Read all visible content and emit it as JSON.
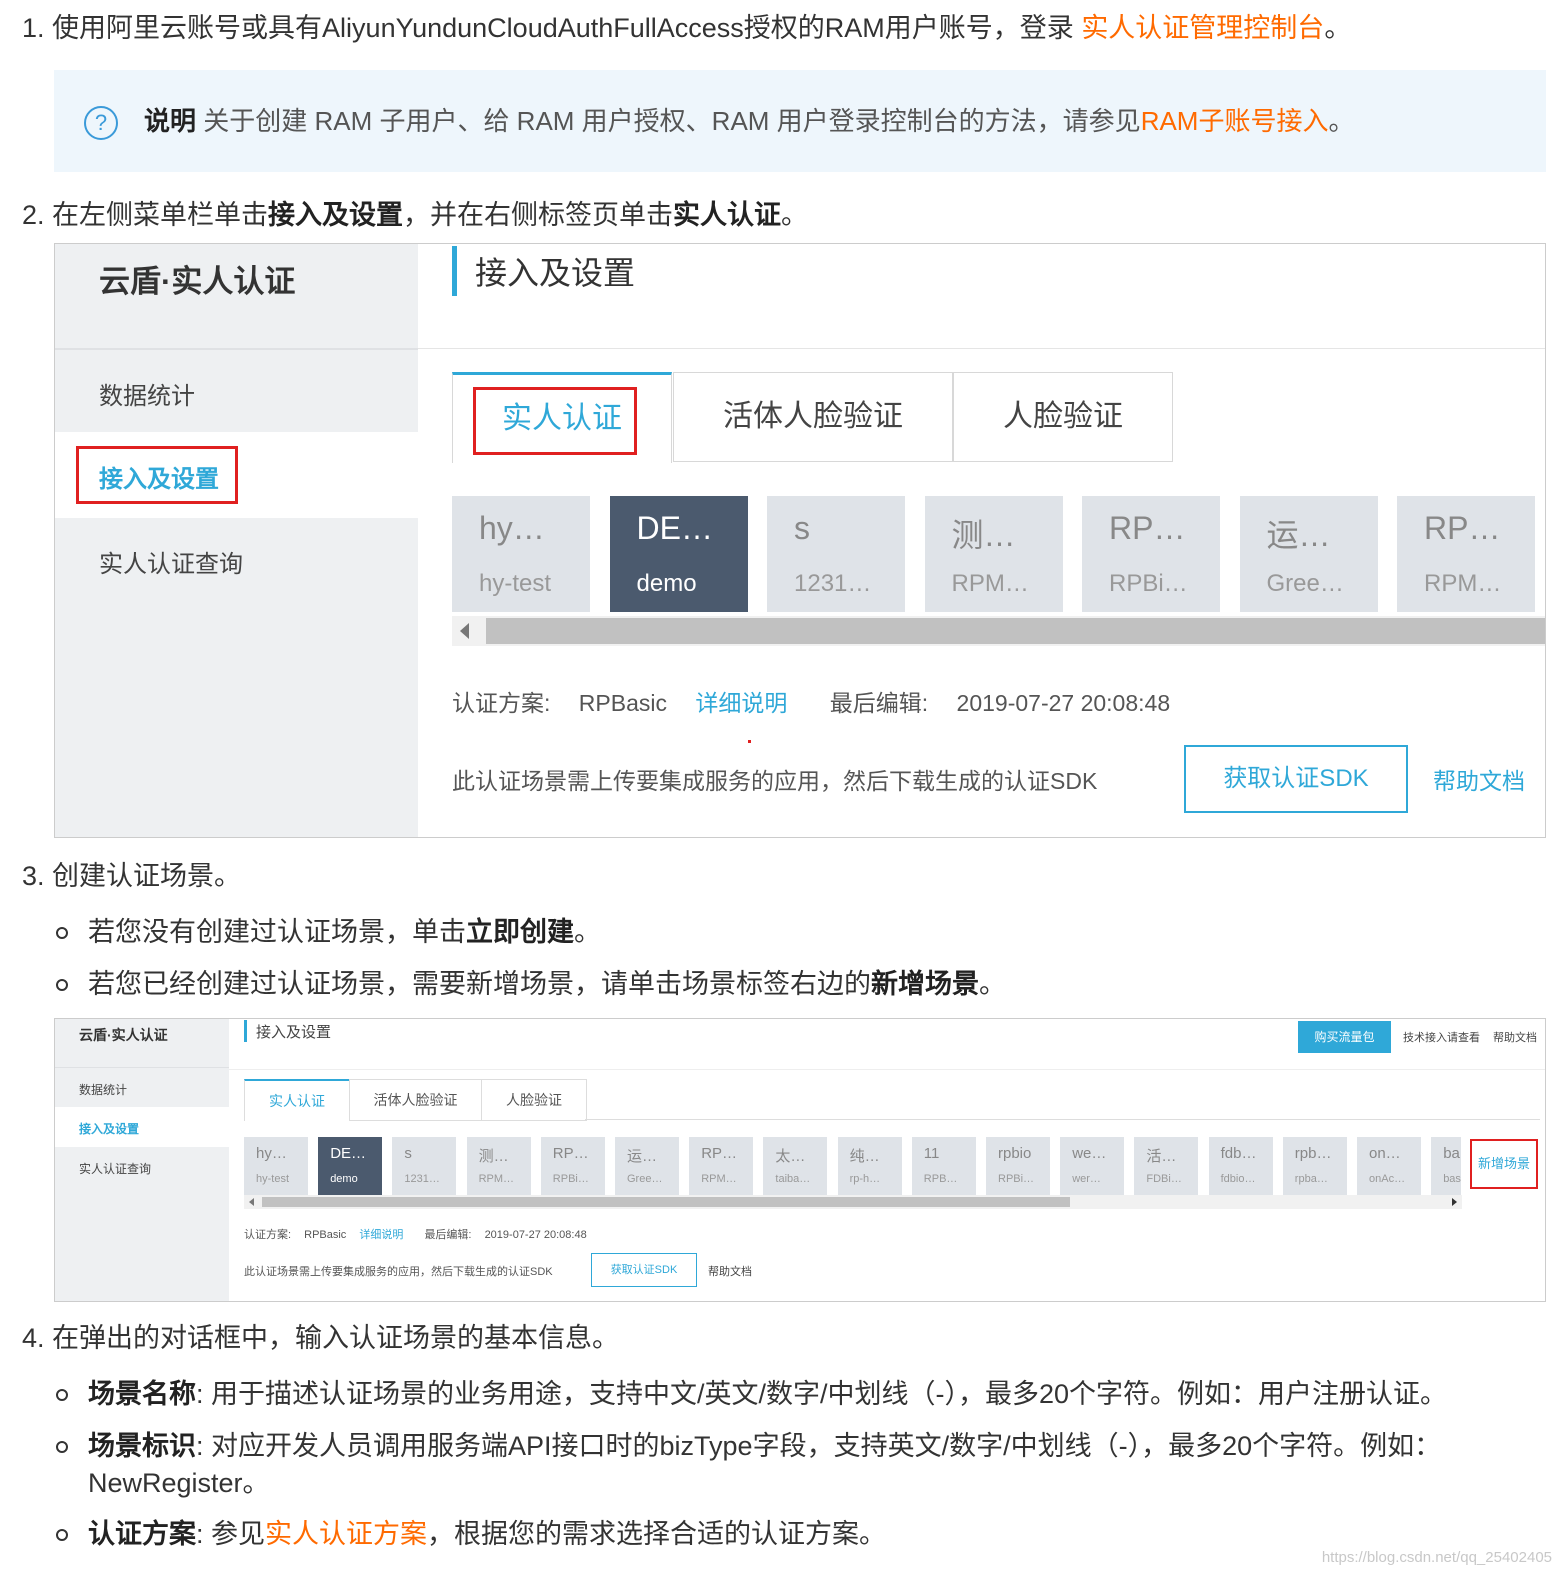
{
  "step1": {
    "num": "1.",
    "text": "使用阿里云账号或具有AliyunYundunCloudAuthFullAccess授权的RAM用户账号，登录 ",
    "link": "实人认证管理控制台",
    "end": "。"
  },
  "note": {
    "label": "说明",
    "text": " 关于创建 RAM 子用户、给 RAM 用户授权、RAM 用户登录控制台的方法，请参见",
    "link": "RAM子账号接入",
    "end": "。"
  },
  "step2": {
    "num": "2.",
    "t1": "在左侧菜单栏单击",
    "b1": "接入及设置",
    "t2": "，并在右侧标签页单击",
    "b2": "实人认证",
    "t3": "。"
  },
  "shot1": {
    "brand": "云盾·实人认证",
    "menu": [
      "数据统计",
      "接入及设置",
      "实人认证查询"
    ],
    "title": "接入及设置",
    "tabs": [
      "实人认证",
      "活体人脸验证",
      "人脸验证"
    ],
    "cards": [
      {
        "t1": "hy…",
        "t2": "hy-test"
      },
      {
        "t1": "DE…",
        "t2": "demo"
      },
      {
        "t1": "s",
        "t2": "1231…"
      },
      {
        "t1": "测…",
        "t2": "RPM…"
      },
      {
        "t1": "RP…",
        "t2": "RPBi…"
      },
      {
        "t1": "运…",
        "t2": "Gree…"
      },
      {
        "t1": "RP…",
        "t2": "RPM…"
      }
    ],
    "scheme_label": "认证方案:",
    "scheme_value": "RPBasic",
    "detail_link": "详细说明",
    "edit_label": "最后编辑:",
    "edit_value": "2019-07-27 20:08:48",
    "sdk_text": "此认证场景需上传要集成服务的应用，然后下载生成的认证SDK",
    "sdk_button": "获取认证SDK",
    "help_link": "帮助文档"
  },
  "step3": {
    "num": "3.",
    "text": "创建认证场景。",
    "b1_t": "若您没有创建过认证场景，单击",
    "b1_b": "立即创建",
    "b1_e": "。",
    "b2_t": "若您已经创建过认证场景，需要新增场景，请单击场景标签右边的",
    "b2_b": "新增场景",
    "b2_e": "。"
  },
  "shot2": {
    "brand": "云盾·实人认证",
    "menu": [
      "数据统计",
      "接入及设置",
      "实人认证查询"
    ],
    "title": "接入及设置",
    "buy_button": "购买流量包",
    "tech_text": "技术接入请查看",
    "help_top": "帮助文档",
    "tabs": [
      "实人认证",
      "活体人脸验证",
      "人脸验证"
    ],
    "cards": [
      {
        "t1": "hy…",
        "t2": "hy-test"
      },
      {
        "t1": "DE…",
        "t2": "demo"
      },
      {
        "t1": "s",
        "t2": "1231…"
      },
      {
        "t1": "测…",
        "t2": "RPM…"
      },
      {
        "t1": "RP…",
        "t2": "RPBi…"
      },
      {
        "t1": "运…",
        "t2": "Gree…"
      },
      {
        "t1": "RP…",
        "t2": "RPM…"
      },
      {
        "t1": "太…",
        "t2": "taiba…"
      },
      {
        "t1": "纯…",
        "t2": "rp-h…"
      },
      {
        "t1": "11",
        "t2": "RPB…"
      },
      {
        "t1": "rpbio",
        "t2": "RPBi…"
      },
      {
        "t1": "we…",
        "t2": "wer…"
      },
      {
        "t1": "活…",
        "t2": "FDBi…"
      },
      {
        "t1": "fdb…",
        "t2": "fdbio…"
      },
      {
        "t1": "rpb…",
        "t2": "rpba…"
      },
      {
        "t1": "on…",
        "t2": "onAc…"
      },
      {
        "t1": "ba",
        "t2": "bas"
      }
    ],
    "add_scene": "新增场景",
    "scheme_label": "认证方案:",
    "scheme_value": "RPBasic",
    "detail_link": "详细说明",
    "edit_label": "最后编辑:",
    "edit_value": "2019-07-27 20:08:48",
    "sdk_text": "此认证场景需上传要集成服务的应用，然后下载生成的认证SDK",
    "sdk_button": "获取认证SDK",
    "help_link": "帮助文档"
  },
  "step4": {
    "num": "4.",
    "text": "在弹出的对话框中，输入认证场景的基本信息。",
    "i1_b": "场景名称",
    "i1_t": ": 用于描述认证场景的业务用途，支持中文/英文/数字/中划线（-），最多20个字符。例如：用户注册认证。",
    "i2_b": "场景标识",
    "i2_t": ": 对应开发人员调用服务端API接口时的bizType字段，支持英文/数字/中划线（-），最多20个字符。例如：",
    "i2_t2": "NewRegister。",
    "i3_b": "认证方案",
    "i3_t": ": 参见",
    "i3_link": "实人认证方案",
    "i3_e": "，根据您的需求选择合适的认证方案。"
  },
  "watermark": "https://blog.csdn.net/qq_25402405"
}
